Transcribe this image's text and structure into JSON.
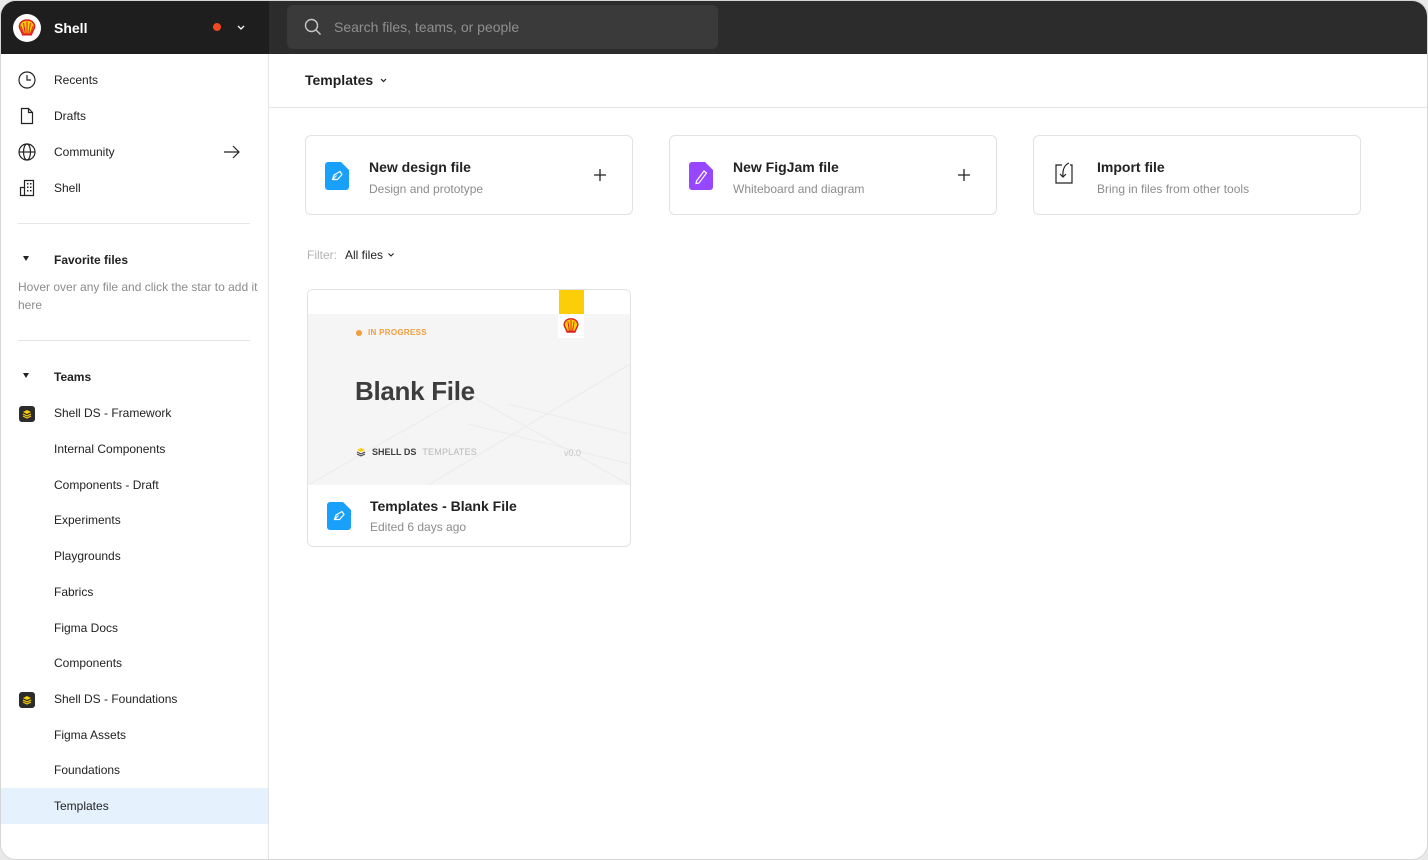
{
  "topbar": {
    "org_name": "Shell",
    "search_placeholder": "Search files, teams, or people"
  },
  "sidebar": {
    "nav": [
      {
        "label": "Recents",
        "icon": "clock-icon"
      },
      {
        "label": "Drafts",
        "icon": "file-icon"
      },
      {
        "label": "Community",
        "icon": "globe-icon"
      },
      {
        "label": "Shell",
        "icon": "building-icon"
      }
    ],
    "favorites": {
      "title": "Favorite files",
      "hint": "Hover over any file and click the star to add it here"
    },
    "teams": {
      "title": "Teams",
      "groups": [
        {
          "name": "Shell DS - Framework",
          "projects": [
            "Internal Components",
            "Components - Draft",
            "Experiments",
            "Playgrounds",
            "Fabrics",
            "Figma Docs",
            "Components"
          ]
        },
        {
          "name": "Shell DS - Foundations",
          "projects": [
            "Figma Assets",
            "Foundations",
            "Templates"
          ]
        }
      ],
      "active_project": "Templates"
    }
  },
  "main": {
    "title": "Templates",
    "actions": [
      {
        "title": "New design file",
        "subtitle": "Design and prototype",
        "icon": "design-file-icon",
        "color": "#18a0fb"
      },
      {
        "title": "New FigJam file",
        "subtitle": "Whiteboard and diagram",
        "icon": "figjam-file-icon",
        "color": "#9747ff"
      },
      {
        "title": "Import file",
        "subtitle": "Bring in files from other tools",
        "icon": "import-icon"
      }
    ],
    "filter": {
      "label": "Filter:",
      "value": "All files"
    },
    "files": [
      {
        "name": "Templates - Blank File",
        "meta": "Edited 6 days ago",
        "thumbnail": {
          "status": "IN PROGRESS",
          "title": "Blank File",
          "brand": "SHELL DS",
          "brand_sub": "TEMPLATES",
          "version": "v0.0"
        }
      }
    ]
  },
  "colors": {
    "accent_blue": "#18a0fb",
    "figjam_purple": "#9747ff",
    "notification": "#f24822",
    "shell_yellow": "#fbce07",
    "shell_red": "#dd1d21",
    "status_orange": "#f39c3b",
    "active_row": "#e5f2fd"
  }
}
